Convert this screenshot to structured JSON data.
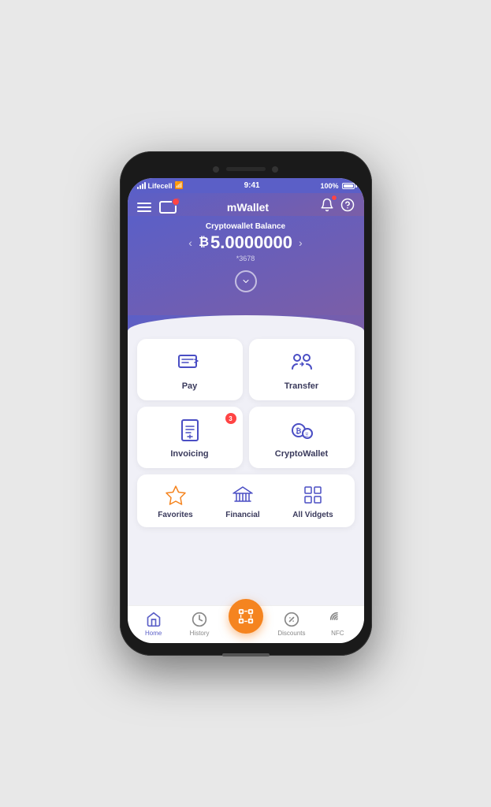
{
  "status": {
    "carrier": "Lifecell",
    "time": "9:41",
    "battery": "100%"
  },
  "header": {
    "title": "mWallet",
    "menu_label": "menu",
    "card_label": "card",
    "bell_label": "notifications",
    "help_label": "help"
  },
  "hero": {
    "balance_label": "Cryptowallet Balance",
    "currency_symbol": "₿",
    "balance": "5.0000000",
    "account_number": "*3678",
    "left_arrow": "‹",
    "right_arrow": "›"
  },
  "actions": [
    {
      "id": "pay",
      "label": "Pay",
      "badge": null
    },
    {
      "id": "transfer",
      "label": "Transfer",
      "badge": null
    },
    {
      "id": "invoicing",
      "label": "Invoicing",
      "badge": "3"
    },
    {
      "id": "cryptowallet",
      "label": "CryptoWallet",
      "badge": null
    }
  ],
  "widgets": [
    {
      "id": "favorites",
      "label": "Favorites"
    },
    {
      "id": "financial",
      "label": "Financial"
    },
    {
      "id": "all-vidgets",
      "label": "All Vidgets"
    }
  ],
  "nav": [
    {
      "id": "home",
      "label": "Home",
      "active": true
    },
    {
      "id": "history",
      "label": "History",
      "active": false
    },
    {
      "id": "scan",
      "label": "Scan",
      "active": false,
      "fab": true
    },
    {
      "id": "discounts",
      "label": "Discounts",
      "active": false
    },
    {
      "id": "nfc",
      "label": "NFC",
      "active": false
    }
  ],
  "colors": {
    "primary": "#5b5fc7",
    "accent": "#f5841f",
    "danger": "#ff4444",
    "text_dark": "#3a3a5c",
    "icon_blue": "#4a4ec4"
  }
}
